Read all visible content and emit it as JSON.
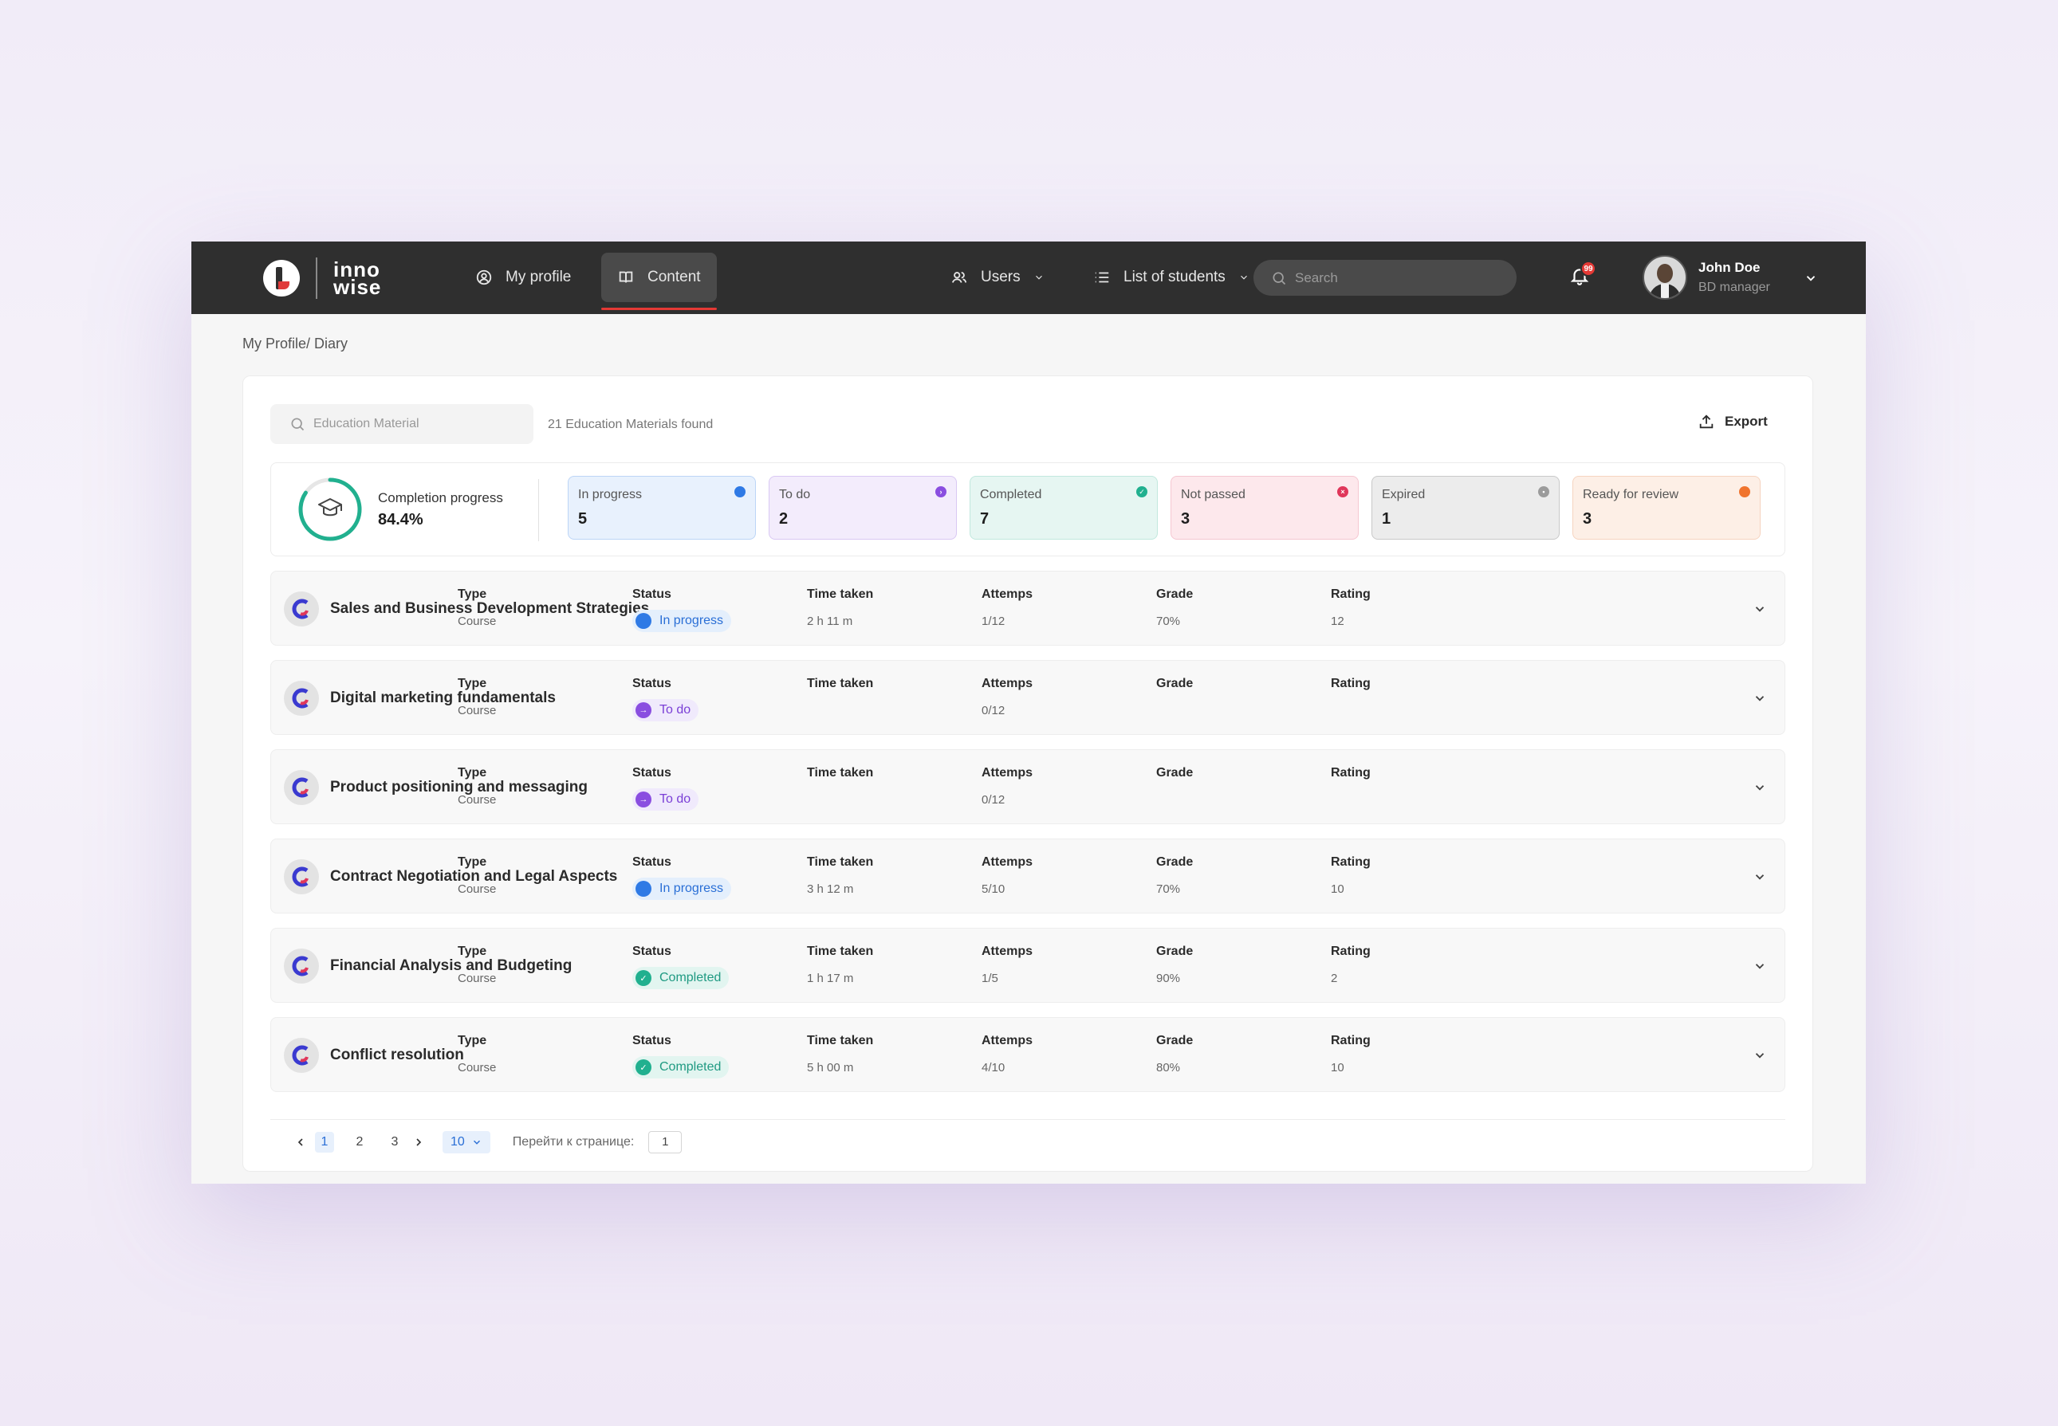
{
  "nav": {
    "logo_line1": "inno",
    "logo_line2": "wise",
    "items": [
      {
        "label": "My profile",
        "icon": "user-circle-icon"
      },
      {
        "label": "Content",
        "icon": "book-icon"
      },
      {
        "label": "Users",
        "icon": "users-icon"
      },
      {
        "label": "List of students",
        "icon": "list-icon"
      }
    ],
    "search_placeholder": "Search",
    "notifications_count": "99",
    "user": {
      "name": "John Doe",
      "role": "BD manager"
    }
  },
  "breadcrumb": "My Profile/ Diary",
  "filter": {
    "search_placeholder": "Education Material",
    "found_text": "21 Education Materials  found",
    "export_label": "Export"
  },
  "stats": {
    "completion_label": "Completion progress",
    "completion_value": "84.4%",
    "completion_fraction": 0.844,
    "cards": [
      {
        "label": "In progress",
        "value": "5",
        "bg": "#e8f1fd",
        "border": "#bcd5f6",
        "dot": "#2f7ae5"
      },
      {
        "label": "To do",
        "value": "2",
        "bg": "#f3ecfc",
        "border": "#d9c8f3",
        "dot": "#8a4ee0"
      },
      {
        "label": "Completed",
        "value": "7",
        "bg": "#e6f6f2",
        "border": "#c1e8de",
        "dot": "#21b08f"
      },
      {
        "label": "Not passed",
        "value": "3",
        "bg": "#fde8ec",
        "border": "#f5c7d1",
        "dot": "#e0365a"
      },
      {
        "label": "Expired",
        "value": "1",
        "bg": "#ececec",
        "border": "#c9c9c9",
        "dot": "#9b9b9b"
      },
      {
        "label": "Ready for review",
        "value": "3",
        "bg": "#fdefe6",
        "border": "#f6d4c0",
        "dot": "#f0742e"
      }
    ]
  },
  "columns": {
    "type": "Type",
    "status": "Status",
    "time": "Time taken",
    "attempts": "Attemps",
    "grade": "Grade",
    "rating": "Rating"
  },
  "rows": [
    {
      "title": "Sales and Business Development Strategies",
      "type": "Course",
      "status": "In progress",
      "time": "2 h 11 m",
      "attempts": "1/12",
      "grade": "70%",
      "rating": "12"
    },
    {
      "title": "Digital marketing fundamentals",
      "type": "Course",
      "status": "To do",
      "time": "",
      "attempts": "0/12",
      "grade": "",
      "rating": ""
    },
    {
      "title": "Product positioning and messaging",
      "type": "Course",
      "status": "To do",
      "time": "",
      "attempts": "0/12",
      "grade": "",
      "rating": ""
    },
    {
      "title": "Contract Negotiation and Legal Aspects",
      "type": "Course",
      "status": "In progress",
      "time": "3 h 12 m",
      "attempts": "5/10",
      "grade": "70%",
      "rating": "10"
    },
    {
      "title": "Financial Analysis and Budgeting",
      "type": "Course",
      "status": "Completed",
      "time": "1 h 17 m",
      "attempts": "1/5",
      "grade": "90%",
      "rating": "2"
    },
    {
      "title": "Conflict resolution",
      "type": "Course",
      "status": "Completed",
      "time": "5 h 00 m",
      "attempts": "4/10",
      "grade": "80%",
      "rating": "10"
    }
  ],
  "pager": {
    "pages": [
      "1",
      "2",
      "3"
    ],
    "current": "1",
    "per_page": "10",
    "goto_label": "Перейти к странице:",
    "goto_value": "1"
  }
}
